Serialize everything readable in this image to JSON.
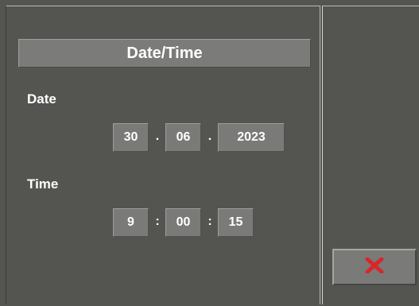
{
  "dialog": {
    "title": "Date/Time",
    "date_label": "Date",
    "time_label": "Time"
  },
  "date": {
    "day": "30",
    "month": "06",
    "year": "2023",
    "separator": "."
  },
  "time": {
    "hour": "9",
    "minute": "00",
    "second": "15",
    "separator": ":"
  },
  "buttons": {
    "cancel_icon": "close-x-icon",
    "cancel_icon_color": "#d8262b"
  }
}
